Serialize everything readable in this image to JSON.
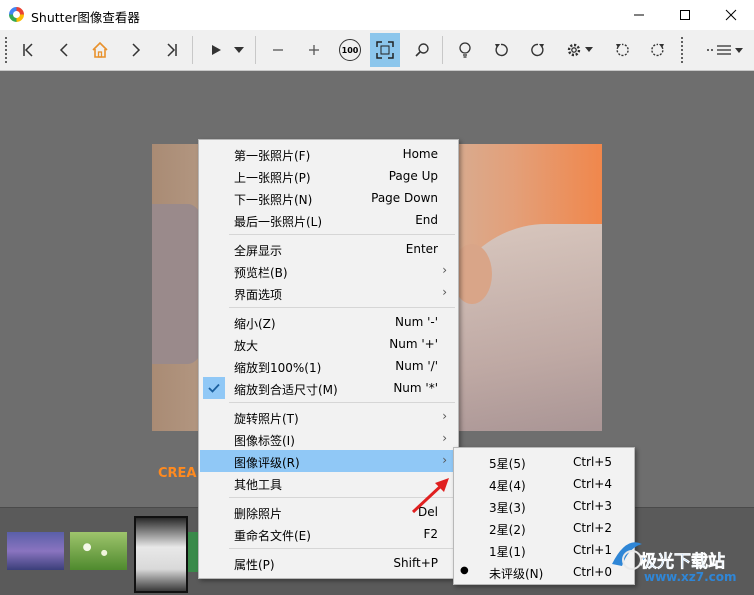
{
  "window": {
    "title": "Shutter图像查看器"
  },
  "title_controls": {
    "minimize": "minimize-icon",
    "maximize": "maximize-icon",
    "close": "close-icon"
  },
  "toolbar": {
    "buttons": [
      "first-icon",
      "prev-icon",
      "home-icon",
      "next-icon",
      "last-icon",
      "play-icon",
      "play-dropdown-icon",
      "zoom-out-icon",
      "zoom-in-icon",
      "zoom-100-icon",
      "fit-icon",
      "search-icon",
      "bulb-icon",
      "rotate-left-icon",
      "rotate-right-icon",
      "settings-icon",
      "flip-left-icon",
      "flip-right-icon",
      "menu-icon"
    ],
    "zoom_100_label": "100",
    "active_button": "fit-icon",
    "accent": "#8cc6ec"
  },
  "viewer": {
    "overlay_text": "CREA"
  },
  "context_menu": {
    "groups": [
      [
        {
          "label": "第一张照片(F)",
          "shortcut": "Home"
        },
        {
          "label": "上一张照片(P)",
          "shortcut": "Page Up"
        },
        {
          "label": "下一张照片(N)",
          "shortcut": "Page Down"
        },
        {
          "label": "最后一张照片(L)",
          "shortcut": "End"
        }
      ],
      [
        {
          "label": "全屏显示",
          "shortcut": "Enter"
        },
        {
          "label": "预览栏(B)",
          "submenu": true
        },
        {
          "label": "界面选项",
          "submenu": true
        }
      ],
      [
        {
          "label": "缩小(Z)",
          "shortcut": "Num '-'"
        },
        {
          "label": "放大",
          "shortcut": "Num '+'"
        },
        {
          "label": "缩放到100%(1)",
          "shortcut": "Num '/'"
        },
        {
          "label": "缩放到合适尺寸(M)",
          "shortcut": "Num '*'",
          "checked": true
        }
      ],
      [
        {
          "label": "旋转照片(T)",
          "submenu": true
        },
        {
          "label": "图像标签(I)",
          "submenu": true
        },
        {
          "label": "图像评级(R)",
          "submenu": true,
          "highlighted": true
        },
        {
          "label": "其他工具"
        }
      ],
      [
        {
          "label": "删除照片",
          "shortcut": "Del"
        },
        {
          "label": "重命名文件(E)",
          "shortcut": "F2"
        }
      ],
      [
        {
          "label": "属性(P)",
          "shortcut": "Shift+P"
        }
      ]
    ],
    "highlight_color": "#90c8f6"
  },
  "rating_submenu": {
    "items": [
      {
        "label": "5星(5)",
        "shortcut": "Ctrl+5"
      },
      {
        "label": "4星(4)",
        "shortcut": "Ctrl+4"
      },
      {
        "label": "3星(3)",
        "shortcut": "Ctrl+3"
      },
      {
        "label": "2星(2)",
        "shortcut": "Ctrl+2"
      },
      {
        "label": "1星(1)",
        "shortcut": "Ctrl+1"
      },
      {
        "label": "未评级(N)",
        "shortcut": "Ctrl+0",
        "selected": true
      }
    ]
  },
  "watermark": {
    "logo_text": "极光下载站",
    "url_text": "www.xz7.com"
  },
  "annotation": {
    "arrow_color": "#e02020"
  }
}
